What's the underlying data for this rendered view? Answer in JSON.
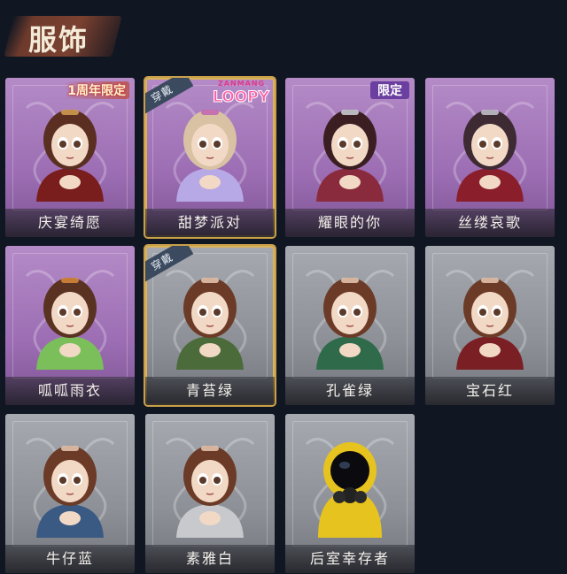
{
  "header": {
    "title": "服饰"
  },
  "costumes": [
    {
      "name": "庆宴绮愿",
      "style": "purple",
      "equipped": false,
      "tag": "1周年限定",
      "tag_kind": "anniversary",
      "hair": "#5a2f22",
      "outfit": "#7a1d1d",
      "accent": "#d4a050"
    },
    {
      "name": "甜梦派对",
      "style": "purple",
      "equipped": true,
      "tag": "LOOPY",
      "tag_kind": "logo",
      "logo_top": "ZANMANG",
      "hair": "#d9c2a3",
      "outfit": "#b7a8e6",
      "accent": "#c264b0"
    },
    {
      "name": "耀眼的你",
      "style": "purple",
      "equipped": false,
      "tag": "限定",
      "tag_kind": "limited",
      "hair": "#3a1e22",
      "outfit": "#8a2b3d",
      "accent": "#cfd4da"
    },
    {
      "name": "丝缕哀歌",
      "style": "purple",
      "equipped": false,
      "tag": "",
      "tag_kind": "",
      "hair": "#3d2a33",
      "outfit": "#8a1e2b",
      "accent": "#c7c7d2"
    },
    {
      "name": "呱呱雨衣",
      "style": "purple",
      "equipped": false,
      "tag": "",
      "tag_kind": "",
      "hair": "#5a3222",
      "outfit": "#7bbf5a",
      "accent": "#d98a3a"
    },
    {
      "name": "青苔绿",
      "style": "gray",
      "equipped": true,
      "tag": "",
      "tag_kind": "",
      "hair": "#6b3b27",
      "outfit": "#4c6b3a",
      "accent": "#e7c9b3"
    },
    {
      "name": "孔雀绿",
      "style": "gray",
      "equipped": false,
      "tag": "",
      "tag_kind": "",
      "hair": "#6b3b27",
      "outfit": "#2f6a4a",
      "accent": "#e7c9b3"
    },
    {
      "name": "宝石红",
      "style": "gray",
      "equipped": false,
      "tag": "",
      "tag_kind": "",
      "hair": "#6b3b27",
      "outfit": "#7a2025",
      "accent": "#e7c9b3"
    },
    {
      "name": "牛仔蓝",
      "style": "gray",
      "equipped": false,
      "tag": "",
      "tag_kind": "",
      "hair": "#6b3b27",
      "outfit": "#3a5a84",
      "accent": "#e7c9b3"
    },
    {
      "name": "素雅白",
      "style": "gray",
      "equipped": false,
      "tag": "",
      "tag_kind": "",
      "hair": "#6b3b27",
      "outfit": "#c7c9cc",
      "accent": "#e7c9b3"
    },
    {
      "name": "后室幸存者",
      "style": "gray",
      "equipped": false,
      "tag": "",
      "tag_kind": "",
      "hair": "#1c1c1c",
      "outfit": "#e6c31e",
      "accent": "#222"
    }
  ],
  "equipped_label": "穿戴"
}
